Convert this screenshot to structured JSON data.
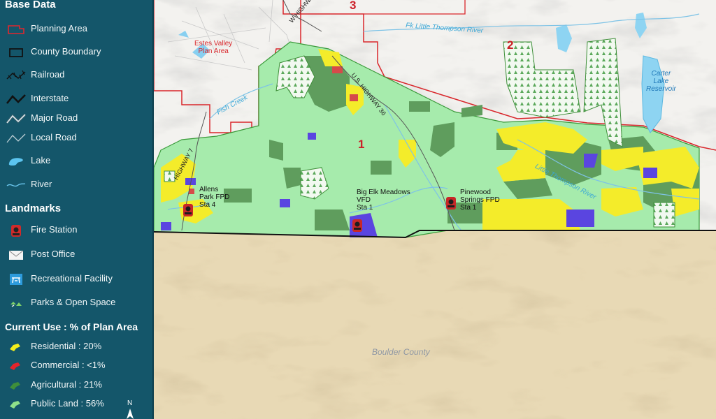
{
  "legend": {
    "base_heading": "Base Data",
    "base_items": [
      {
        "label": "Planning Area",
        "icon": "planning-area-icon"
      },
      {
        "label": "County Boundary",
        "icon": "county-boundary-icon"
      },
      {
        "label": "Railroad",
        "icon": "railroad-icon"
      },
      {
        "label": "Interstate",
        "icon": "interstate-icon"
      },
      {
        "label": "Major Road",
        "icon": "major-road-icon"
      },
      {
        "label": "Local Road",
        "icon": "local-road-icon"
      },
      {
        "label": "Lake",
        "icon": "lake-icon"
      },
      {
        "label": "River",
        "icon": "river-icon"
      }
    ],
    "landmarks_heading": "Landmarks",
    "landmark_items": [
      {
        "label": "Fire Station",
        "icon": "fire-station-icon"
      },
      {
        "label": "Post Office",
        "icon": "post-office-icon"
      },
      {
        "label": "Recreational Facility",
        "icon": "recreational-facility-icon"
      },
      {
        "label": "Parks & Open Space",
        "icon": "parks-open-space-icon"
      }
    ],
    "use_heading": "Current Use : % of Plan Area",
    "use_items": [
      {
        "label": "Residential : 20%",
        "color": "#f2ee1c"
      },
      {
        "label": "Commercial : <1%",
        "color": "#e3242b"
      },
      {
        "label": "Agricultural : 21%",
        "color": "#3f8f3a"
      },
      {
        "label": "Public Land : 56%",
        "color": "#8fe08a"
      }
    ],
    "north_letter": "N"
  },
  "map": {
    "colors": {
      "public_land": "#a6ebac",
      "agricultural": "#5f9d5d",
      "residential": "#f4ec2a",
      "commercial": "#d64a4a",
      "institutional": "#5a45e0",
      "boulder_county": "#e8d9b5",
      "planning_area_line": "#d9262b",
      "river": "#7ec3e6"
    },
    "area_numbers": {
      "one": "1",
      "two": "2",
      "three": "3"
    },
    "labels": {
      "estes_valley": "Estes Valley\nPlan Area",
      "fish_creek": "Fish Creek",
      "little_thompson_river": "Fk Little Thompson River",
      "carter_lake": "Carter\nLake\nReservoir",
      "little_thompson": "Little Thompson River",
      "highway_36": "U.S. HIGHWAY 36",
      "highway_7": "HIGHWAY 7",
      "w_highway": "W HIGHWAY",
      "allens_park": "Allens\nPark FPD\nSta 4",
      "big_elk": "Big Elk Meadows\nVFD\nSta 1",
      "pinewood": "Pinewood\nSprings FPD\nSta 1",
      "boulder_county": "Boulder County"
    }
  }
}
